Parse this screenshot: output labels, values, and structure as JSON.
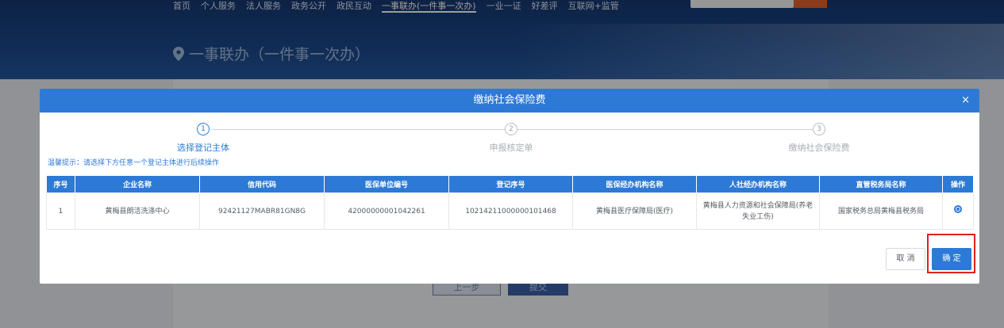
{
  "nav": {
    "items": [
      "首页",
      "个人服务",
      "法人服务",
      "政务公开",
      "政民互动",
      "一事联办(一件事一次办)",
      "一业一证",
      "好差评",
      "互联网+监管"
    ],
    "active_index": 5
  },
  "page": {
    "title": "一事联办（一件事一次办）",
    "prev_label": "上一步",
    "submit_label": "提交"
  },
  "modal": {
    "title": "缴纳社会保险费",
    "close": "×",
    "steps": [
      {
        "num": "1",
        "label": "选择登记主体"
      },
      {
        "num": "2",
        "label": "申报核定单"
      },
      {
        "num": "3",
        "label": "缴纳社会保险费"
      }
    ],
    "hint": "温馨提示：请选择下方任意一个登记主体进行后续操作",
    "table": {
      "headers": [
        "序号",
        "企业名称",
        "信用代码",
        "医保单位编号",
        "登记序号",
        "医保经办机构名称",
        "人社经办机构名称",
        "直管税务局名称",
        "操作"
      ],
      "rows": [
        [
          "1",
          "黄梅县朗洁洗涤中心",
          "92421127MABR81GN8G",
          "42000000001042261",
          "10214211000000101468",
          "黄梅县医疗保障局(医疗)",
          "黄梅县人力资源和社会保障局(养老失业工伤)",
          "国家税务总局黄梅县税务局"
        ]
      ]
    },
    "cancel_label": "取 消",
    "ok_label": "确 定"
  },
  "colors": {
    "primary": "#2d7ad6",
    "highlight": "#e0201c",
    "header_bg": "#1a4688"
  }
}
